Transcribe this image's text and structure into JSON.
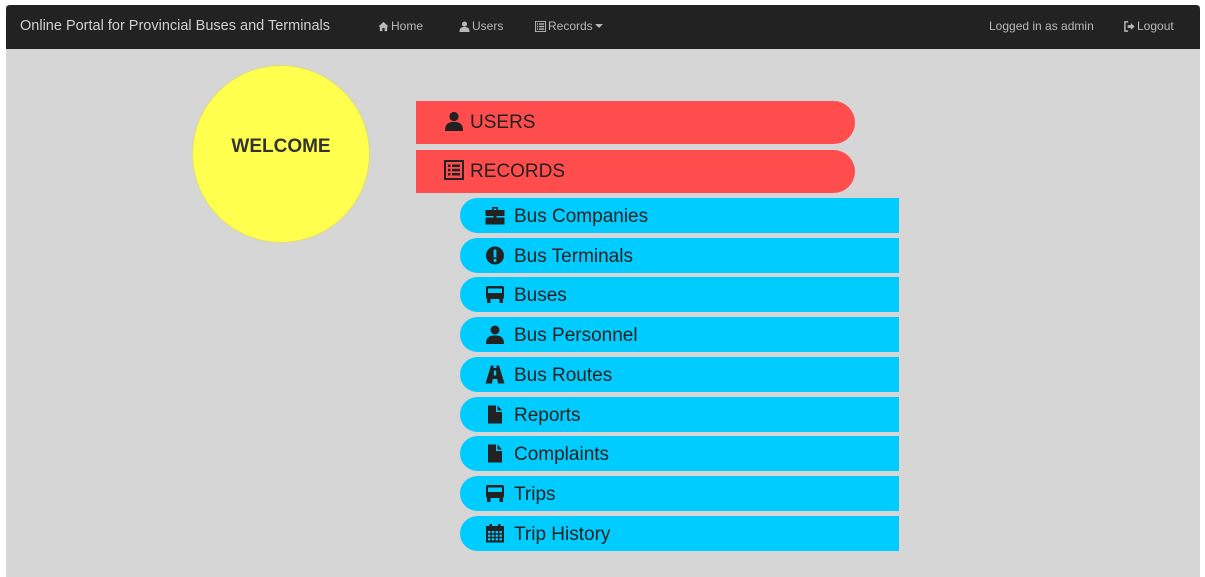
{
  "navbar": {
    "brand": "Online Portal for Provincial Buses and Terminals",
    "home_label": "Home",
    "users_label": "Users",
    "records_label": "Records",
    "logged_in_text": "Logged in as admin",
    "logout_label": "Logout"
  },
  "welcome": {
    "text": "WELCOME"
  },
  "menu": {
    "users_label": "USERS",
    "records_label": "RECORDS",
    "items": [
      {
        "label": "Bus Companies",
        "icon": "briefcase-icon"
      },
      {
        "label": "Bus Terminals",
        "icon": "exclamation-sign-icon"
      },
      {
        "label": "Buses",
        "icon": "bus-icon"
      },
      {
        "label": "Bus Personnel",
        "icon": "user-icon"
      },
      {
        "label": "Bus Routes",
        "icon": "road-icon"
      },
      {
        "label": "Reports",
        "icon": "file-icon"
      },
      {
        "label": "Complaints",
        "icon": "file-icon"
      },
      {
        "label": "Trips",
        "icon": "bus-icon"
      },
      {
        "label": "Trip History",
        "icon": "calendar-icon"
      }
    ]
  },
  "colors": {
    "navbar_bg": "#222222",
    "page_bg": "#d6d6d6",
    "welcome_circle": "#ffff4d",
    "main_button": "#ff4d4d",
    "sub_button": "#00ccff"
  }
}
